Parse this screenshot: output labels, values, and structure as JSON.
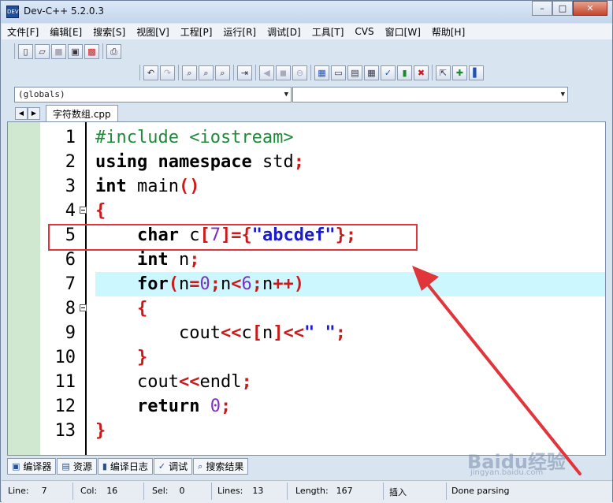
{
  "window": {
    "title": "Dev-C++ 5.2.0.3"
  },
  "menu": [
    "文件[F]",
    "编辑[E]",
    "搜索[S]",
    "视图[V]",
    "工程[P]",
    "运行[R]",
    "调试[D]",
    "工具[T]",
    "CVS",
    "窗口[W]",
    "帮助[H]"
  ],
  "combo": {
    "scope": "(globals)",
    "symbol": ""
  },
  "file_tab": "字符数组.cpp",
  "editor": {
    "current_line": 7,
    "lines": [
      {
        "num": "1",
        "html_kind": "include",
        "parts": [
          [
            "pp",
            "#include <iostream>"
          ]
        ]
      },
      {
        "num": "2",
        "parts": [
          [
            "kw",
            "using"
          ],
          [
            "",
            " "
          ],
          [
            "kw",
            "namespace"
          ],
          [
            "",
            " std"
          ],
          [
            "sym",
            ";"
          ]
        ]
      },
      {
        "num": "3",
        "parts": [
          [
            "kw",
            "int"
          ],
          [
            "",
            " main"
          ],
          [
            "sym",
            "()"
          ]
        ]
      },
      {
        "num": "4",
        "fold": true,
        "parts": [
          [
            "sym",
            "{"
          ]
        ]
      },
      {
        "num": "5",
        "parts": [
          [
            "",
            "    "
          ],
          [
            "kw",
            "char"
          ],
          [
            "",
            " c"
          ],
          [
            "sym",
            "["
          ],
          [
            "num",
            "7"
          ],
          [
            "sym",
            "]={"
          ],
          [
            "str",
            "\"abcdef\""
          ],
          [
            "sym",
            "};"
          ]
        ]
      },
      {
        "num": "6",
        "parts": [
          [
            "",
            "    "
          ],
          [
            "kw",
            "int"
          ],
          [
            "",
            " n"
          ],
          [
            "sym",
            ";"
          ]
        ]
      },
      {
        "num": "7",
        "parts": [
          [
            "",
            "    "
          ],
          [
            "kw",
            "for"
          ],
          [
            "sym",
            "("
          ],
          [
            "",
            "n"
          ],
          [
            "sym",
            "="
          ],
          [
            "num",
            "0"
          ],
          [
            "sym",
            ";"
          ],
          [
            "",
            "n"
          ],
          [
            "sym",
            "<"
          ],
          [
            "num",
            "6"
          ],
          [
            "sym",
            ";"
          ],
          [
            "",
            "n"
          ],
          [
            "sym",
            "++)"
          ]
        ]
      },
      {
        "num": "8",
        "fold": true,
        "parts": [
          [
            "",
            "    "
          ],
          [
            "sym",
            "{"
          ]
        ]
      },
      {
        "num": "9",
        "parts": [
          [
            "",
            "        cout"
          ],
          [
            "sym",
            "<<"
          ],
          [
            "",
            "c"
          ],
          [
            "sym",
            "["
          ],
          [
            "",
            "n"
          ],
          [
            "sym",
            "]<<"
          ],
          [
            "str",
            "\" \""
          ],
          [
            "sym",
            ";"
          ]
        ]
      },
      {
        "num": "10",
        "parts": [
          [
            "",
            "    "
          ],
          [
            "sym",
            "}"
          ]
        ]
      },
      {
        "num": "11",
        "parts": [
          [
            "",
            "    cout"
          ],
          [
            "sym",
            "<<"
          ],
          [
            "",
            "endl"
          ],
          [
            "sym",
            ";"
          ]
        ]
      },
      {
        "num": "12",
        "parts": [
          [
            "",
            "    "
          ],
          [
            "kw",
            "return"
          ],
          [
            "",
            " "
          ],
          [
            "num",
            "0"
          ],
          [
            "sym",
            ";"
          ]
        ]
      },
      {
        "num": "13",
        "parts": [
          [
            "sym",
            "}"
          ]
        ]
      }
    ]
  },
  "bottom_tabs": [
    {
      "icon": "compiler-icon",
      "label": "编译器"
    },
    {
      "icon": "resource-icon",
      "label": "资源"
    },
    {
      "icon": "chart-icon",
      "label": "编译日志"
    },
    {
      "icon": "check-icon",
      "label": "调试"
    },
    {
      "icon": "search-icon",
      "label": "搜索结果"
    }
  ],
  "status": {
    "line_label": "Line:",
    "line_value": "7",
    "col_label": "Col:",
    "col_value": "16",
    "sel_label": "Sel:",
    "sel_value": "0",
    "lines_label": "Lines:",
    "lines_value": "13",
    "length_label": "Length:",
    "length_value": "167",
    "mode": "插入",
    "message": "Done parsing"
  },
  "watermark": {
    "brand": "Baidu经验",
    "url": "jingyan.baidu.com"
  },
  "colors": {
    "keyword": "#000000",
    "preprocessor": "#1f8a3a",
    "symbol": "#cc1a1a",
    "number": "#7b2fbe",
    "string": "#1a1ad0",
    "current_line_bg": "#ccf7ff",
    "annotation": "#e0353a"
  }
}
